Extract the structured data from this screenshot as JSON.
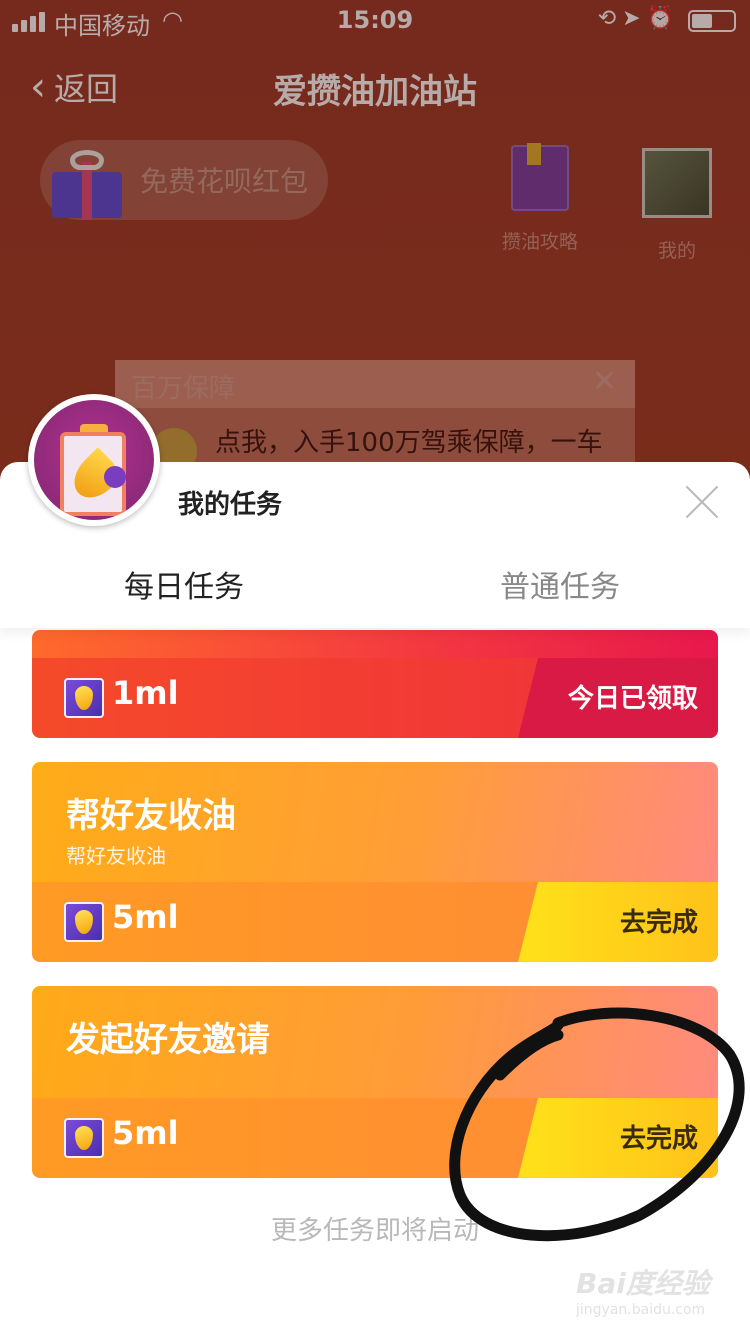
{
  "status_bar": {
    "carrier": "中国移动",
    "time": "15:09"
  },
  "nav": {
    "back_label": "返回",
    "title": "爱攒油加油站"
  },
  "background": {
    "promo_label": "免费花呗红包",
    "guide_label": "攒油攻略",
    "mine_label": "我的",
    "notice_title": "百万保障",
    "notice_body": "点我，入手100万驾乘保障，一车"
  },
  "sheet": {
    "title": "我的任务",
    "tabs": [
      {
        "label": "每日任务",
        "active": true
      },
      {
        "label": "普通任务",
        "active": false
      }
    ]
  },
  "tasks": [
    {
      "title": "",
      "subtitle": "",
      "reward": "1ml",
      "action": "今日已领取"
    },
    {
      "title": "帮好友收油",
      "subtitle": "帮好友收油",
      "reward": "5ml",
      "action": "去完成"
    },
    {
      "title": "发起好友邀请",
      "subtitle": "",
      "reward": "5ml",
      "action": "去完成"
    }
  ],
  "footer_note": "更多任务即将启动",
  "watermark": {
    "main": "Bai度经验",
    "sub": "jingyan.baidu.com"
  },
  "colors": {
    "accent_red": "#ef2f3c",
    "accent_orange": "#ff9a24",
    "action_yellow": "#ffe11a"
  }
}
